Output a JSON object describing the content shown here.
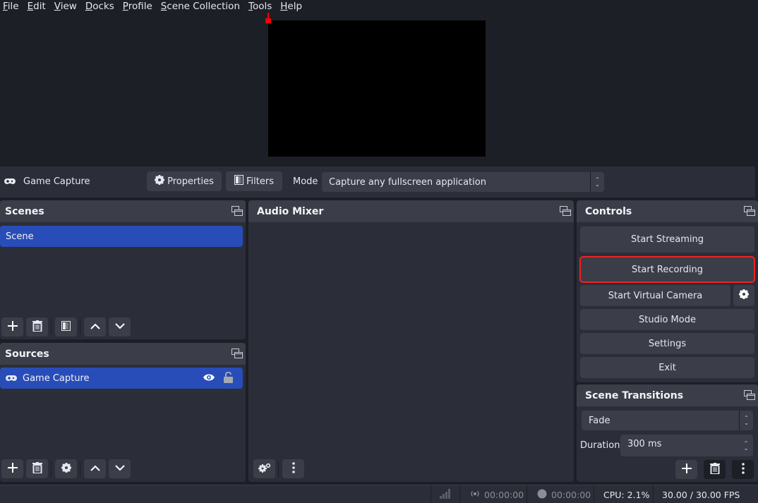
{
  "menu": [
    {
      "label": "File",
      "accel": "F",
      "rest": "ile"
    },
    {
      "label": "Edit",
      "accel": "E",
      "rest": "dit"
    },
    {
      "label": "View",
      "accel": "V",
      "rest": "iew"
    },
    {
      "label": "Docks",
      "accel": "D",
      "rest": "ocks"
    },
    {
      "label": "Profile",
      "accel": "P",
      "rest": "rofile"
    },
    {
      "label": "Scene Collection",
      "accel": "S",
      "rest": "cene Collection"
    },
    {
      "label": "Tools",
      "accel": "T",
      "rest": "ools"
    },
    {
      "label": "Help",
      "accel": "H",
      "rest": "elp"
    }
  ],
  "source_toolbar": {
    "source_icon": "gamepad-icon",
    "source_name": "Game Capture",
    "properties_label": "Properties",
    "filters_label": "Filters",
    "mode_label": "Mode",
    "mode_value": "Capture any fullscreen application"
  },
  "scenes": {
    "title": "Scenes",
    "items": [
      {
        "label": "Scene",
        "selected": true
      }
    ]
  },
  "sources": {
    "title": "Sources",
    "items": [
      {
        "label": "Game Capture",
        "icon": "gamepad-icon",
        "visible": true,
        "locked": false,
        "selected": true
      }
    ]
  },
  "audio_mixer": {
    "title": "Audio Mixer"
  },
  "controls": {
    "title": "Controls",
    "start_streaming": "Start Streaming",
    "start_recording": "Start Recording",
    "start_virtual_camera": "Start Virtual Camera",
    "studio_mode": "Studio Mode",
    "settings": "Settings",
    "exit": "Exit"
  },
  "scene_transitions": {
    "title": "Scene Transitions",
    "transition_value": "Fade",
    "duration_label": "Duration",
    "duration_value": "300 ms"
  },
  "statusbar": {
    "stream_time": "00:00:00",
    "record_time": "00:00:00",
    "cpu": "CPU: 2.1%",
    "fps": "30.00 / 30.00 FPS"
  },
  "colors": {
    "accent_selected": "#284cb8",
    "highlight_border": "#ee2222",
    "preview_handle": "#ff0000"
  }
}
